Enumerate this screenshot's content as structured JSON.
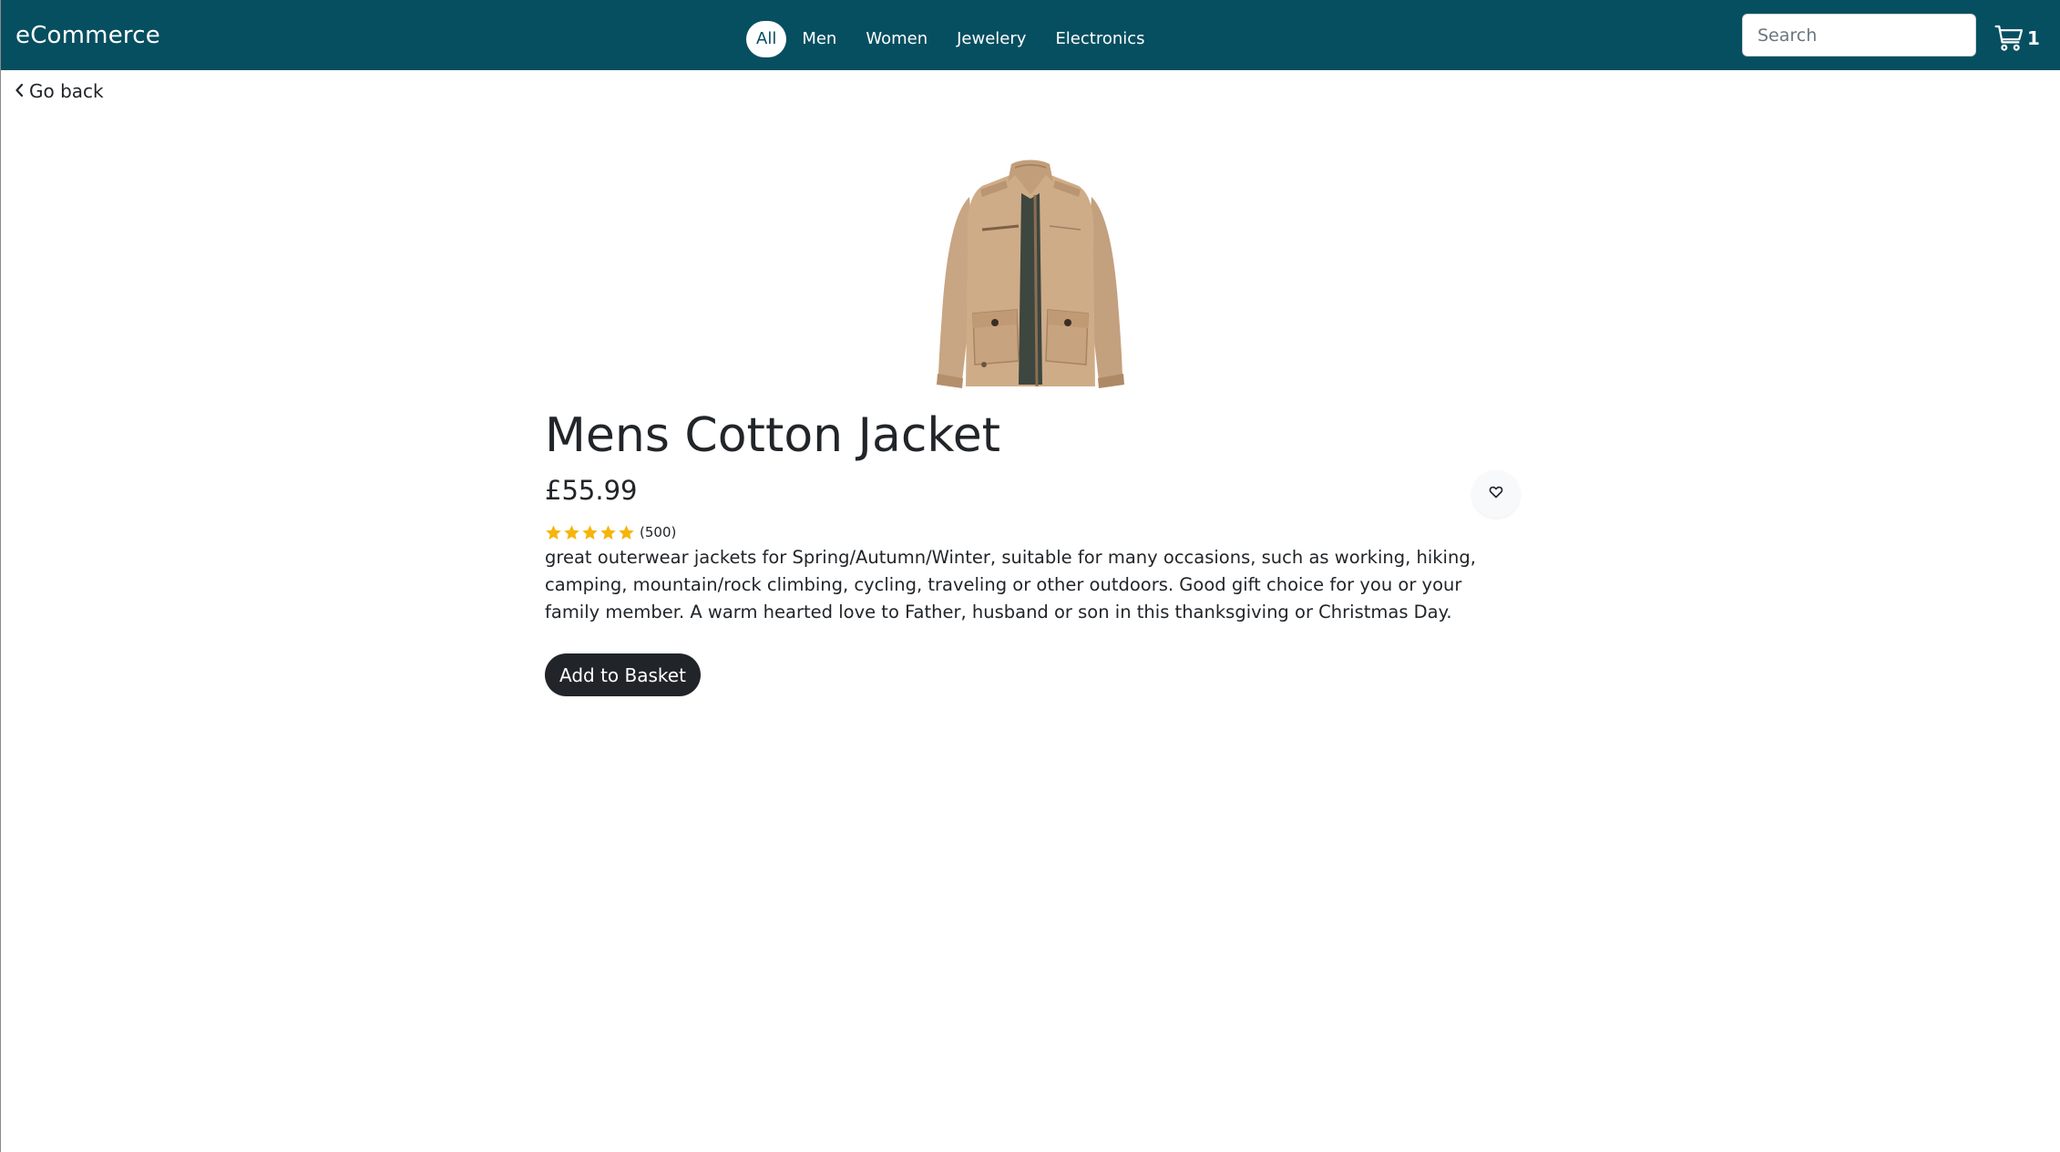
{
  "navbar": {
    "brand": "eCommerce",
    "categories": [
      {
        "label": "All",
        "active": true
      },
      {
        "label": "Men",
        "active": false
      },
      {
        "label": "Women",
        "active": false
      },
      {
        "label": "Jewelery",
        "active": false
      },
      {
        "label": "Electronics",
        "active": false
      }
    ],
    "search": {
      "placeholder": "Search",
      "value": ""
    },
    "cart": {
      "icon": "cart-icon",
      "count": "1"
    }
  },
  "back": {
    "label": "Go back",
    "icon": "chevron-left-icon"
  },
  "product": {
    "image_alt": "jacket-image",
    "title": "Mens Cotton Jacket",
    "price": "£55.99",
    "favorite_icon": "heart-icon",
    "rating": {
      "stars": 5,
      "max": 5,
      "count_label": "(500)"
    },
    "description": "great outerwear jackets for Spring/Autumn/Winter, suitable for many occasions, such as working, hiking, camping, mountain/rock climbing, cycling, traveling or other outdoors. Good gift choice for you or your family member. A warm hearted love to Father, husband or son in this thanksgiving or Christmas Day.",
    "add_button": "Add to Basket"
  },
  "colors": {
    "navbar": "#064f60",
    "star": "#f5b50a",
    "button": "#212529"
  }
}
